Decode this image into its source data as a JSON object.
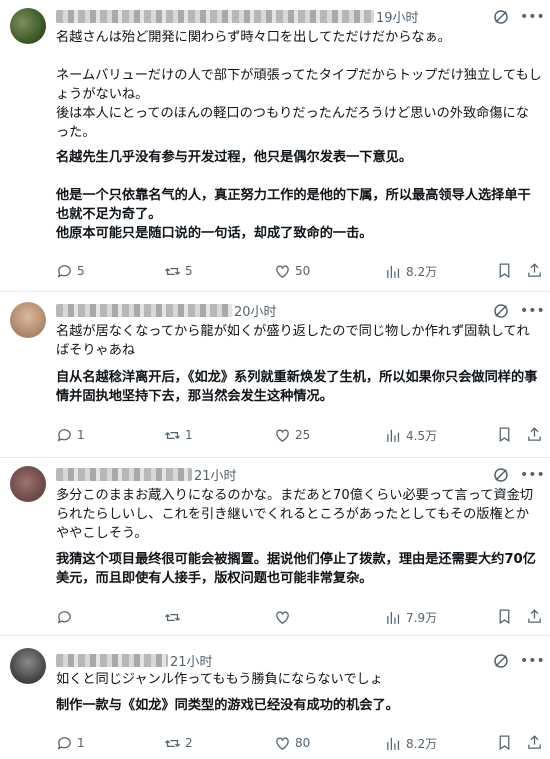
{
  "posts": [
    {
      "time": "19小时",
      "jp": [
        "名越さんは殆ど開発に関わらず時々口を出してただけだからなぁ。",
        "",
        "ネームバリューだけの人で部下が頑張ってたタイプだからトップだけ独立してもしょうがないね。",
        "後は本人にとってのほんの軽口のつもりだったんだろうけど思いの外致命傷になった。"
      ],
      "zh": [
        "名越先生几乎没有参与开发过程，他只是偶尔发表一下意见。",
        "",
        "他是一个只依靠名气的人，真正努力工作的是他的下属，所以最高领导人选择单干也就不足为奇了。",
        "他原本可能只是随口说的一句话，却成了致命的一击。"
      ],
      "replies": "5",
      "reposts": "5",
      "likes": "50",
      "views": "8.2万"
    },
    {
      "time": "20小时",
      "jp": [
        "名越が居なくなってから龍が如くが盛り返したので同じ物しか作れず固執してればそりゃあね"
      ],
      "zh": [
        "自从名越稔洋离开后，《如龙》系列就重新焕发了生机，所以如果你只会做同样的事情并固执地坚持下去，那当然会发生这种情况。"
      ],
      "replies": "1",
      "reposts": "1",
      "likes": "25",
      "views": "4.5万"
    },
    {
      "time": "21小时",
      "jp": [
        "多分このままお蔵入りになるのかな。まだあと70億くらい必要って言って資金切られたらしいし、これを引き継いでくれるところがあったとしてもその版権とかややこしそう。"
      ],
      "zh": [
        "我猜这个项目最终很可能会被搁置。据说他们停止了拨款，理由是还需要大约70亿美元，而且即使有人接手，版权问题也可能非常复杂。"
      ],
      "replies": "",
      "reposts": "",
      "likes": "",
      "views": "7.9万"
    },
    {
      "time": "21小时",
      "jp": [
        "如くと同じジャンル作ってももう勝負にならないでしょ"
      ],
      "zh": [
        "制作一款与《如龙》同类型的游戏已经没有成功的机会了。"
      ],
      "replies": "1",
      "reposts": "2",
      "likes": "80",
      "views": "8.2万"
    }
  ],
  "icons": {
    "reply": "reply-icon",
    "repost": "repost-icon",
    "like": "like-icon",
    "views": "views-icon",
    "bookmark": "bookmark-icon",
    "share": "share-icon",
    "grok": "grok-icon",
    "more": "more-icon"
  }
}
